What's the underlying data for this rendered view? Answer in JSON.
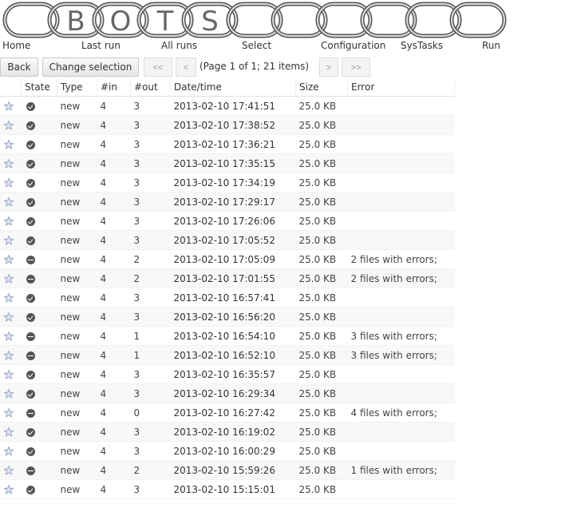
{
  "banner": {
    "letters": [
      "B",
      "O",
      "T",
      "S"
    ]
  },
  "nav": {
    "items": [
      {
        "label": "Home"
      },
      {
        "label": "Last run"
      },
      {
        "label": "All runs"
      },
      {
        "label": "Select"
      },
      {
        "label": "Configuration"
      },
      {
        "label": "SysTasks"
      },
      {
        "label": "Run"
      }
    ]
  },
  "toolbar": {
    "back_label": "Back",
    "change_selection_label": "Change selection",
    "first_label": "<<",
    "prev_label": "<",
    "page_info": "(Page 1 of 1; 21 items)",
    "next_label": ">",
    "last_label": ">>"
  },
  "table": {
    "headers": {
      "state": "State",
      "type": "Type",
      "in": "#in",
      "out": "#out",
      "datetime": "Date/time",
      "size": "Size",
      "error": "Error"
    },
    "rows": [
      {
        "state": "ok",
        "type": "new",
        "in": "4",
        "out": "3",
        "datetime": "2013-02-10 17:41:51",
        "size": "25.0 KB",
        "error": ""
      },
      {
        "state": "ok",
        "type": "new",
        "in": "4",
        "out": "3",
        "datetime": "2013-02-10 17:38:52",
        "size": "25.0 KB",
        "error": ""
      },
      {
        "state": "ok",
        "type": "new",
        "in": "4",
        "out": "3",
        "datetime": "2013-02-10 17:36:21",
        "size": "25.0 KB",
        "error": ""
      },
      {
        "state": "ok",
        "type": "new",
        "in": "4",
        "out": "3",
        "datetime": "2013-02-10 17:35:15",
        "size": "25.0 KB",
        "error": ""
      },
      {
        "state": "ok",
        "type": "new",
        "in": "4",
        "out": "3",
        "datetime": "2013-02-10 17:34:19",
        "size": "25.0 KB",
        "error": ""
      },
      {
        "state": "ok",
        "type": "new",
        "in": "4",
        "out": "3",
        "datetime": "2013-02-10 17:29:17",
        "size": "25.0 KB",
        "error": ""
      },
      {
        "state": "ok",
        "type": "new",
        "in": "4",
        "out": "3",
        "datetime": "2013-02-10 17:26:06",
        "size": "25.0 KB",
        "error": ""
      },
      {
        "state": "ok",
        "type": "new",
        "in": "4",
        "out": "3",
        "datetime": "2013-02-10 17:05:52",
        "size": "25.0 KB",
        "error": ""
      },
      {
        "state": "err",
        "type": "new",
        "in": "4",
        "out": "2",
        "datetime": "2013-02-10 17:05:09",
        "size": "25.0 KB",
        "error": "2 files with errors;"
      },
      {
        "state": "err",
        "type": "new",
        "in": "4",
        "out": "2",
        "datetime": "2013-02-10 17:01:55",
        "size": "25.0 KB",
        "error": "2 files with errors;"
      },
      {
        "state": "ok",
        "type": "new",
        "in": "4",
        "out": "3",
        "datetime": "2013-02-10 16:57:41",
        "size": "25.0 KB",
        "error": ""
      },
      {
        "state": "ok",
        "type": "new",
        "in": "4",
        "out": "3",
        "datetime": "2013-02-10 16:56:20",
        "size": "25.0 KB",
        "error": ""
      },
      {
        "state": "err",
        "type": "new",
        "in": "4",
        "out": "1",
        "datetime": "2013-02-10 16:54:10",
        "size": "25.0 KB",
        "error": "3 files with errors;"
      },
      {
        "state": "err",
        "type": "new",
        "in": "4",
        "out": "1",
        "datetime": "2013-02-10 16:52:10",
        "size": "25.0 KB",
        "error": "3 files with errors;"
      },
      {
        "state": "ok",
        "type": "new",
        "in": "4",
        "out": "3",
        "datetime": "2013-02-10 16:35:57",
        "size": "25.0 KB",
        "error": ""
      },
      {
        "state": "ok",
        "type": "new",
        "in": "4",
        "out": "3",
        "datetime": "2013-02-10 16:29:34",
        "size": "25.0 KB",
        "error": ""
      },
      {
        "state": "err",
        "type": "new",
        "in": "4",
        "out": "0",
        "datetime": "2013-02-10 16:27:42",
        "size": "25.0 KB",
        "error": "4 files with errors;"
      },
      {
        "state": "ok",
        "type": "new",
        "in": "4",
        "out": "3",
        "datetime": "2013-02-10 16:19:02",
        "size": "25.0 KB",
        "error": ""
      },
      {
        "state": "ok",
        "type": "new",
        "in": "4",
        "out": "3",
        "datetime": "2013-02-10 16:00:29",
        "size": "25.0 KB",
        "error": ""
      },
      {
        "state": "err",
        "type": "new",
        "in": "4",
        "out": "2",
        "datetime": "2013-02-10 15:59:26",
        "size": "25.0 KB",
        "error": "1 files with errors;"
      },
      {
        "state": "ok",
        "type": "new",
        "in": "4",
        "out": "3",
        "datetime": "2013-02-10 15:15:01",
        "size": "25.0 KB",
        "error": ""
      }
    ]
  }
}
